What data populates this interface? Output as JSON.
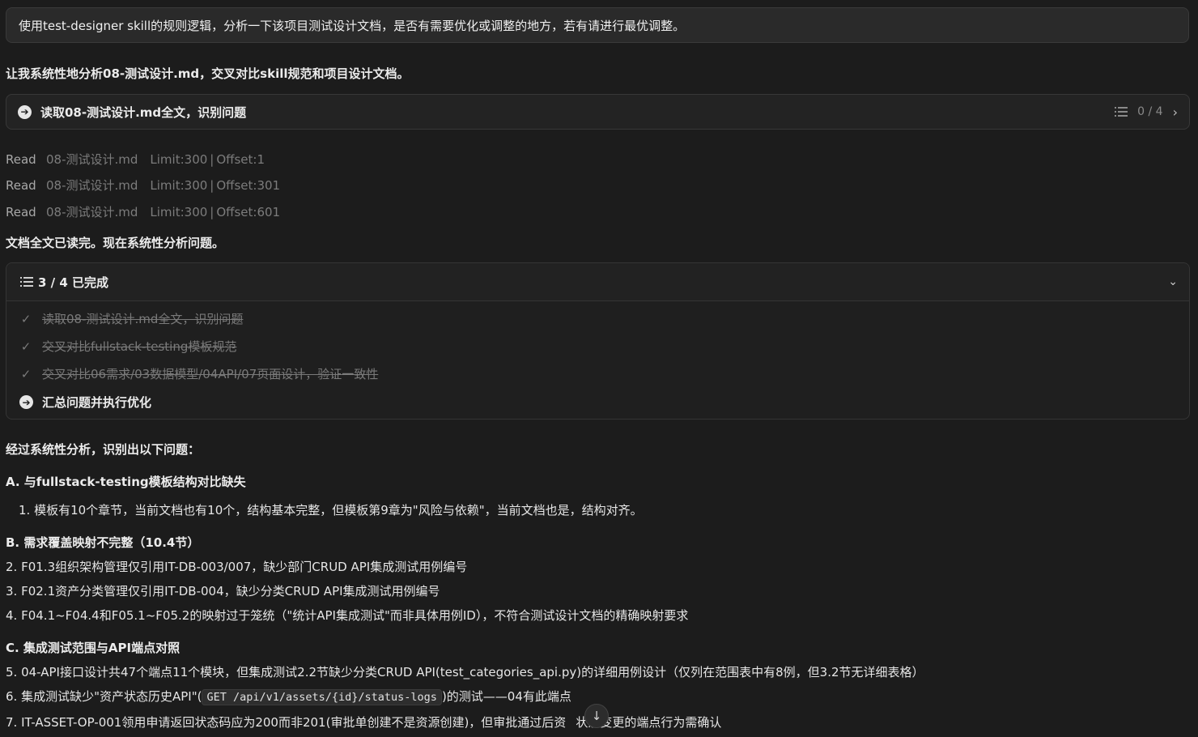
{
  "prompt": "使用test-designer skill的规则逻辑，分析一下该项目测试设计文档，是否有需要优化或调整的地方，若有请进行最优调整。",
  "intro": "让我系统性地分析08-测试设计.md，交叉对比skill规范和项目设计文档。",
  "task_bar": {
    "title": "读取08-测试设计.md全文，识别问题",
    "progress": "0 / 4"
  },
  "reads": [
    {
      "verb": "Read",
      "file": "08-测试设计.md",
      "limit": "Limit:300",
      "offset": "Offset:1"
    },
    {
      "verb": "Read",
      "file": "08-测试设计.md",
      "limit": "Limit:300",
      "offset": "Offset:301"
    },
    {
      "verb": "Read",
      "file": "08-测试设计.md",
      "limit": "Limit:300",
      "offset": "Offset:601"
    }
  ],
  "done_text": "文档全文已读完。现在系统性分析问题。",
  "todo": {
    "header": "3 / 4 已完成",
    "items": [
      {
        "label": "读取08-测试设计.md全文，识别问题",
        "status": "done"
      },
      {
        "label": "交叉对比fullstack-testing模板规范",
        "status": "done"
      },
      {
        "label": "交叉对比06需求/03数据模型/04API/07页面设计，验证一致性",
        "status": "done"
      },
      {
        "label": "汇总问题并执行优化",
        "status": "active"
      }
    ]
  },
  "analysis": {
    "heading": "经过系统性分析，识别出以下问题：",
    "section_a": "A. 与fullstack-testing模板结构对比缺失",
    "a1": "1. 模板有10个章节，当前文档也有10个，结构基本完整，但模板第9章为\"风险与依赖\"，当前文档也是，结构对齐。",
    "section_b": "B. 需求覆盖映射不完整（10.4节）",
    "b2": "2. F01.3组织架构管理仅引用IT-DB-003/007，缺少部门CRUD API集成测试用例编号",
    "b3": "3. F02.1资产分类管理仅引用IT-DB-004，缺少分类CRUD API集成测试用例编号",
    "b4": "4. F04.1~F04.4和F05.1~F05.2的映射过于笼统（\"统计API集成测试\"而非具体用例ID），不符合测试设计文档的精确映射要求",
    "section_c": "C. 集成测试范围与API端点对照",
    "c5": "5. 04-API接口设计共47个端点11个模块，但集成测试2.2节缺少分类CRUD API(test_categories_api.py)的详细用例设计（仅列在范围表中有8例，但3.2节无详细表格）",
    "c6_pre": "6. 集成测试缺少\"资产状态历史API\"(",
    "c6_code": "GET /api/v1/assets/{id}/status-logs",
    "c6_post": ")的测试——04有此端点",
    "c7_pre": "7. IT-ASSET-OP-001领用申请返回状态码应为200而非201(审批单创建不是资源创建)，但审批通过后资",
    "c7_post": "状态变更的端点行为需确认"
  }
}
